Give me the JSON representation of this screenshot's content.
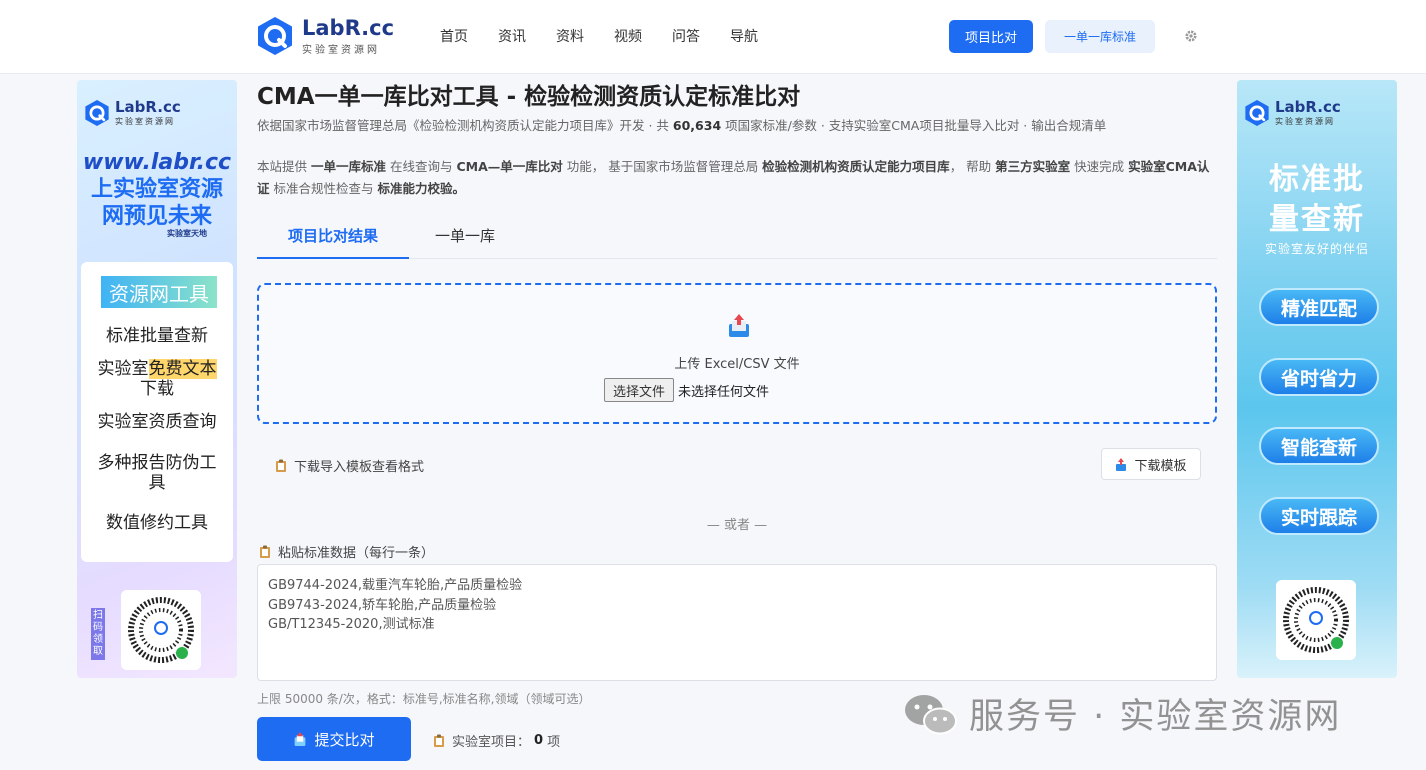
{
  "header": {
    "logo_name": "LabR.cc",
    "logo_sub": "实验室资源网",
    "nav": [
      "首页",
      "资讯",
      "资料",
      "视频",
      "问答",
      "导航"
    ],
    "btn_compare": "项目比对",
    "btn_standard": "一单一库标准",
    "settings_icon": "gear-icon"
  },
  "left_banner": {
    "logo_name": "LabR.cc",
    "logo_sub": "实验室资源网",
    "url": "www.labr.cc",
    "slogan_1": "上实验室资源",
    "slogan_2": "网预见未来",
    "sub": "实验室天地",
    "tag": "资源网工具",
    "items": [
      "标准批量查新",
      "实验室",
      "免费文本",
      "下载",
      "实验室资质查询",
      "多种报告防伪工",
      "具",
      "数值修约工具"
    ],
    "scan": "扫码领取"
  },
  "right_banner": {
    "logo_name": "LabR.cc",
    "logo_sub": "实验室资源网",
    "title_1": "标准批",
    "title_2": "量查新",
    "sub": "实验室友好的伴侣",
    "pills": [
      "精准匹配",
      "省时省力",
      "智能查新",
      "实时跟踪"
    ]
  },
  "page": {
    "title": "CMA一单一库比对工具 - 检验检测资质认定标准比对",
    "subtitle_pre": "依据国家市场监督管理总局《检验检测机构资质认定能力项目库》开发 · 共",
    "subtitle_count": "60,634",
    "subtitle_post": "项国家标准/参数 · 支持实验室CMA项目批量导入比对 · 输出合规清单",
    "intro": [
      {
        "t": "本站提供 ",
        "b": false
      },
      {
        "t": "一单一库标准",
        "b": true
      },
      {
        "t": " 在线查询与 ",
        "b": false
      },
      {
        "t": "CMA—单一库比对",
        "b": true
      },
      {
        "t": " 功能， 基于国家市场监督管理总局 ",
        "b": false
      },
      {
        "t": "检验检测机构资质认定能力项目库",
        "b": true
      },
      {
        "t": "， 帮助 ",
        "b": false
      },
      {
        "t": "第三方实验室",
        "b": true
      },
      {
        "t": " 快速完成 ",
        "b": false
      },
      {
        "t": "实验室CMA认证",
        "b": true
      },
      {
        "t": " 标准合规性检查与 ",
        "b": false
      },
      {
        "t": "标准能力校验。",
        "b": true
      }
    ],
    "tabs": [
      "项目比对结果",
      "一单一库"
    ],
    "upload_text": "上传 Excel/CSV 文件",
    "file_button": "选择文件",
    "file_none": "未选择任何文件",
    "template_link": "下载导入模板查看格式",
    "template_button": "下载模板",
    "or": "— 或者 —",
    "paste_label": "粘贴标准数据（每行一条）",
    "paste_lines": [
      "GB9744-2024,载重汽车轮胎,产品质量检验",
      "GB9743-2024,轿车轮胎,产品质量检验",
      "GB/T12345-2020,测试标准"
    ],
    "hint": "上限 50000 条/次，格式：标准号,标准名称,领域（领域可选）",
    "submit": "提交比对",
    "count_label": "实验室项目：",
    "count_value": "0",
    "count_unit": "项"
  },
  "watermark": {
    "text": "服务号 · 实验室资源网"
  },
  "colors": {
    "primary": "#1e6cf2",
    "light": "#e9f1fd"
  }
}
